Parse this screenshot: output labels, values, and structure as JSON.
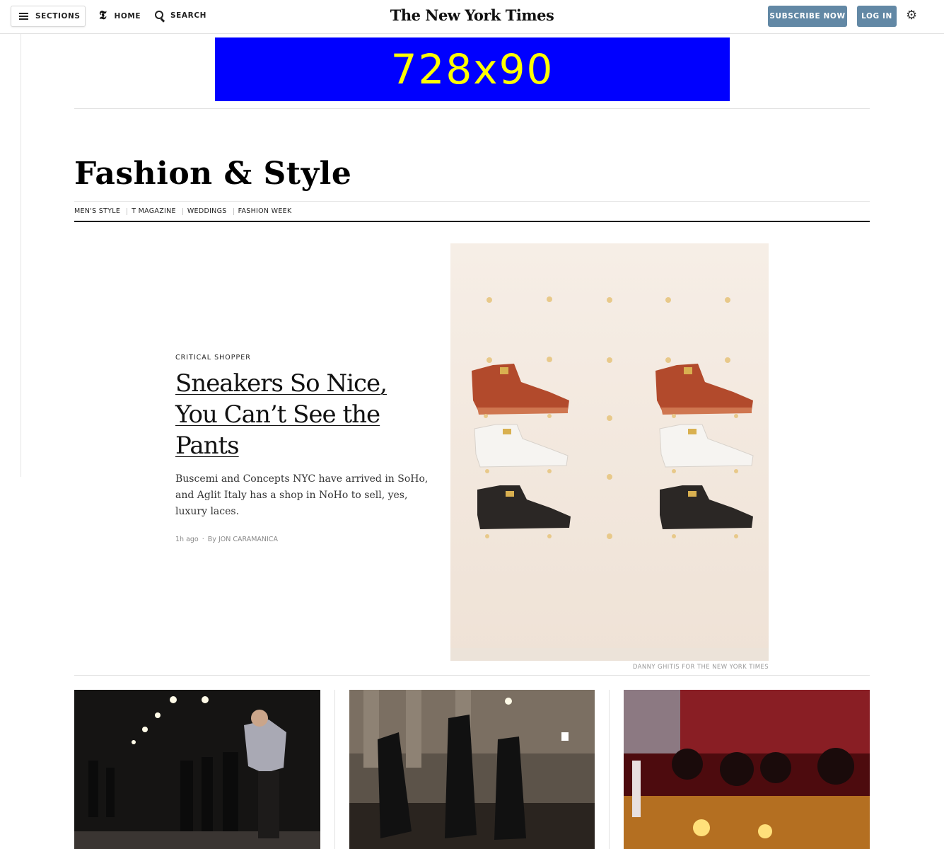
{
  "header": {
    "sections_label": "SECTIONS",
    "home_label": "HOME",
    "search_label": "SEARCH",
    "masthead": "The New York Times",
    "subscribe_label": "SUBSCRIBE NOW",
    "login_label": "LOG IN",
    "icons": {
      "sections": "hamburger-menu-icon",
      "home": "nyt-t-logo-icon",
      "search": "search-icon",
      "settings": "gear-icon"
    },
    "colors": {
      "button": "#6288a5"
    }
  },
  "ad": {
    "text": "728x90",
    "background": "#0000ff",
    "text_color": "#ffff00"
  },
  "section": {
    "title": "Fashion & Style",
    "subnav": [
      "MEN'S STYLE",
      "T MAGAZINE",
      "WEDDINGS",
      "FASHION WEEK"
    ]
  },
  "lead_story": {
    "kicker": "CRITICAL SHOPPER",
    "headline": "Sneakers So Nice, You Can’t See the Pants",
    "summary": "Buscemi and Concepts NYC have arrived in SoHo, and Aglit Italy has a shop in NoHo to sell, yes, luxury laces.",
    "time": "1h ago",
    "byline_prefix": "By",
    "author": "JON CARAMANICA",
    "image_credit": "DANNY GHITIS FOR THE NEW YORK TIMES"
  }
}
